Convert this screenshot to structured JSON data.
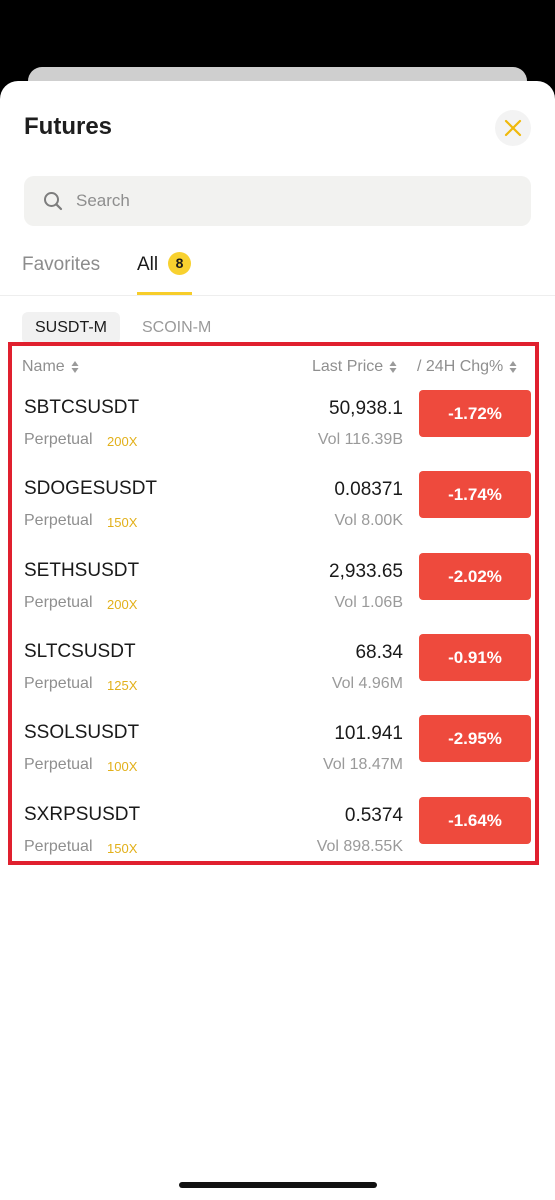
{
  "header": {
    "title": "Futures"
  },
  "search": {
    "placeholder": "Search"
  },
  "tabs": [
    {
      "label": "Favorites"
    },
    {
      "label": "All",
      "badge": "8"
    }
  ],
  "subtabs": [
    {
      "label": "SUSDT-M"
    },
    {
      "label": "SCOIN-M"
    }
  ],
  "columns": {
    "name": "Name",
    "last_price": "Last Price",
    "change": "/ 24H Chg%"
  },
  "rows": [
    {
      "symbol": "SBTCSUSDT",
      "type": "Perpetual",
      "leverage": "200X",
      "price": "50,938.1",
      "volume": "Vol 116.39B",
      "change": "-1.72%"
    },
    {
      "symbol": "SDOGESUSDT",
      "type": "Perpetual",
      "leverage": "150X",
      "price": "0.08371",
      "volume": "Vol 8.00K",
      "change": "-1.74%"
    },
    {
      "symbol": "SETHSUSDT",
      "type": "Perpetual",
      "leverage": "200X",
      "price": "2,933.65",
      "volume": "Vol 1.06B",
      "change": "-2.02%"
    },
    {
      "symbol": "SLTCSUSDT",
      "type": "Perpetual",
      "leverage": "125X",
      "price": "68.34",
      "volume": "Vol 4.96M",
      "change": "-0.91%"
    },
    {
      "symbol": "SSOLSUSDT",
      "type": "Perpetual",
      "leverage": "100X",
      "price": "101.941",
      "volume": "Vol 18.47M",
      "change": "-2.95%"
    },
    {
      "symbol": "SXRPSUSDT",
      "type": "Perpetual",
      "leverage": "150X",
      "price": "0.5374",
      "volume": "Vol 898.55K",
      "change": "-1.64%"
    }
  ],
  "colors": {
    "accent": "#f7cd2a",
    "negative": "#ee4a3d",
    "highlight_border": "#e0202e",
    "leverage": "#e2b01a"
  }
}
